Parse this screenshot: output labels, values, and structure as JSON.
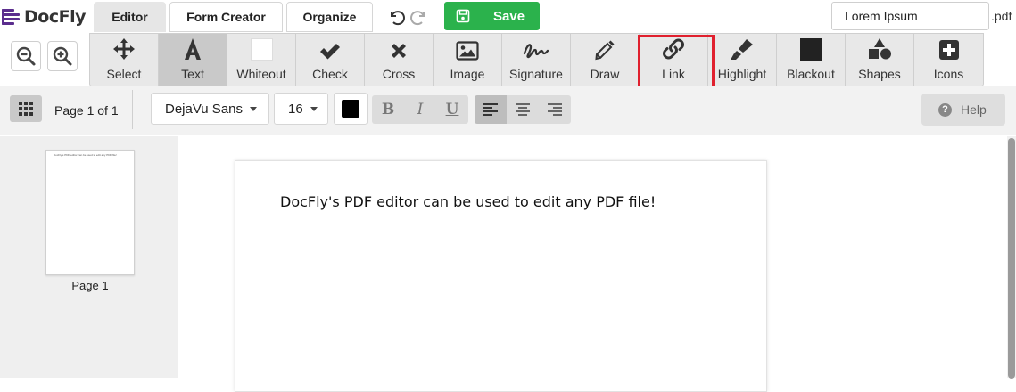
{
  "app": {
    "logo_text": "DocFly",
    "brand_color": "#5b2d8e",
    "accent_color": "#2bb24c"
  },
  "tabs": [
    {
      "label": "Editor",
      "active": true
    },
    {
      "label": "Form Creator",
      "active": false
    },
    {
      "label": "Organize",
      "active": false
    }
  ],
  "actions": {
    "undo_icon": "undo-icon",
    "redo_icon": "redo-icon",
    "save_label": "Save"
  },
  "file": {
    "name_value": "Lorem Ipsum",
    "extension": ".pdf"
  },
  "zoom": {
    "zoom_out_icon": "zoom-out-icon",
    "zoom_in_icon": "zoom-in-icon"
  },
  "tools": [
    {
      "label": "Select",
      "icon": "move-arrows-icon",
      "selected": false,
      "highlighted": false
    },
    {
      "label": "Text",
      "icon": "text-a-icon",
      "selected": true,
      "highlighted": false
    },
    {
      "label": "Whiteout",
      "icon": "whiteout-square-icon",
      "selected": false,
      "highlighted": false
    },
    {
      "label": "Check",
      "icon": "checkmark-icon",
      "selected": false,
      "highlighted": false
    },
    {
      "label": "Cross",
      "icon": "cross-icon",
      "selected": false,
      "highlighted": false
    },
    {
      "label": "Image",
      "icon": "image-icon",
      "selected": false,
      "highlighted": false
    },
    {
      "label": "Signature",
      "icon": "signature-icon",
      "selected": false,
      "highlighted": false
    },
    {
      "label": "Draw",
      "icon": "pencil-icon",
      "selected": false,
      "highlighted": false
    },
    {
      "label": "Link",
      "icon": "link-icon",
      "selected": false,
      "highlighted": true
    },
    {
      "label": "Highlight",
      "icon": "highlighter-icon",
      "selected": false,
      "highlighted": false
    },
    {
      "label": "Blackout",
      "icon": "blackout-square-icon",
      "selected": false,
      "highlighted": false
    },
    {
      "label": "Shapes",
      "icon": "shapes-icon",
      "selected": false,
      "highlighted": false
    },
    {
      "label": "Icons",
      "icon": "plus-square-icon",
      "selected": false,
      "highlighted": false
    }
  ],
  "format": {
    "page_info": "Page 1 of 1",
    "font_family": "DejaVu Sans",
    "font_size": "16",
    "text_color": "#000000",
    "bold": "B",
    "italic": "I",
    "underline": "U",
    "align_left_active": true,
    "help_label": "Help"
  },
  "document": {
    "thumbnail_label": "Page 1",
    "page_text": "DocFly's PDF editor can be used to edit any PDF file!"
  }
}
